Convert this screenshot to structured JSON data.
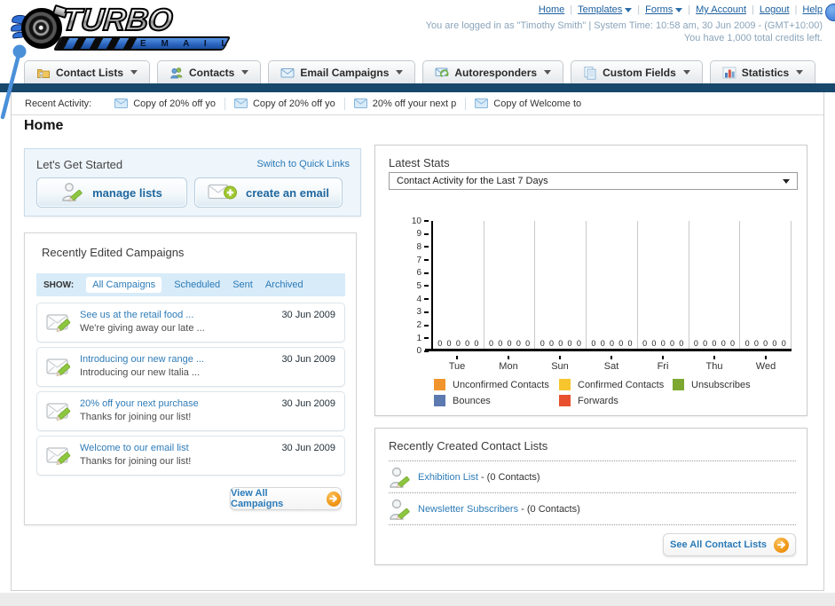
{
  "header": {
    "logo": {
      "title": "TURBO",
      "subtitle": "E M A I L"
    },
    "nav_links": [
      "Home",
      "Templates",
      "Forms",
      "My Account",
      "Logout",
      "Help"
    ],
    "login_line": "You are logged in as \"Timothy Smith\" | System Time: 10:58 am, 30 Jun 2009 - (GMT+10:00)",
    "credits_line": "You have 1,000 total credits left."
  },
  "tabs": [
    {
      "label": "Contact Lists",
      "icon": "folder-icon"
    },
    {
      "label": "Contacts",
      "icon": "people-icon"
    },
    {
      "label": "Email Campaigns",
      "icon": "envelope-icon"
    },
    {
      "label": "Autoresponders",
      "icon": "envelope-arrow-icon"
    },
    {
      "label": "Custom Fields",
      "icon": "pages-icon"
    },
    {
      "label": "Statistics",
      "icon": "bar-chart-icon"
    }
  ],
  "recent_activity": {
    "label": "Recent Activity:",
    "items": [
      "Copy of 20% off yo",
      "Copy of 20% off yo",
      "20% off your next p",
      "Copy of Welcome to"
    ]
  },
  "page_title": "Home",
  "get_started": {
    "title": "Let's Get Started",
    "switch_link": "Switch to Quick Links",
    "buttons": [
      {
        "label": "manage lists"
      },
      {
        "label": "create an email"
      }
    ]
  },
  "campaigns": {
    "title": "Recently Edited Campaigns",
    "show_label": "SHOW:",
    "filters": [
      "All Campaigns",
      "Scheduled",
      "Sent",
      "Archived"
    ],
    "active_filter": "All Campaigns",
    "items": [
      {
        "title": "See us at the retail food ...",
        "subtitle": "We're giving away our late ...",
        "date": "30 Jun 2009"
      },
      {
        "title": "Introducing our new range ...",
        "subtitle": "Introducing our new Italia ...",
        "date": "30 Jun 2009"
      },
      {
        "title": "20% off your next purchase",
        "subtitle": "Thanks for joining our list!",
        "date": "30 Jun 2009"
      },
      {
        "title": "Welcome to our email list",
        "subtitle": "Thanks for joining our list!",
        "date": "30 Jun 2009"
      }
    ],
    "view_all_label": "View All Campaigns"
  },
  "stats": {
    "title": "Latest Stats",
    "dropdown_value": "Contact Activity for the Last 7 Days"
  },
  "chart_data": {
    "type": "bar",
    "title": "Contact Activity for the Last 7 Days",
    "categories": [
      "Tue",
      "Mon",
      "Sun",
      "Sat",
      "Fri",
      "Thu",
      "Wed"
    ],
    "series": [
      {
        "name": "Unconfirmed Contacts",
        "color": "#F2942D",
        "values": [
          0,
          0,
          0,
          0,
          0,
          0,
          0
        ]
      },
      {
        "name": "Confirmed Contacts",
        "color": "#F7C62F",
        "values": [
          0,
          0,
          0,
          0,
          0,
          0,
          0
        ]
      },
      {
        "name": "Unsubscribes",
        "color": "#7CA832",
        "values": [
          0,
          0,
          0,
          0,
          0,
          0,
          0
        ]
      },
      {
        "name": "Bounces",
        "color": "#5C79B0",
        "values": [
          0,
          0,
          0,
          0,
          0,
          0,
          0
        ]
      },
      {
        "name": "Forwards",
        "color": "#E8502F",
        "values": [
          0,
          0,
          0,
          0,
          0,
          0,
          0
        ]
      }
    ],
    "xlabel": "",
    "ylabel": "",
    "ylim": [
      0,
      10
    ],
    "yticks": [
      0,
      1,
      2,
      3,
      4,
      5,
      6,
      7,
      8,
      9,
      10
    ],
    "grid": "vertical-group-separators",
    "legend_position": "bottom"
  },
  "contact_lists": {
    "title": "Recently Created Contact Lists",
    "items": [
      {
        "name": "Exhibition List",
        "suffix": " - (0 Contacts)"
      },
      {
        "name": "Newsletter Subscribers",
        "suffix": " - (0 Contacts)"
      }
    ],
    "see_all_label": "See All Contact Lists"
  }
}
